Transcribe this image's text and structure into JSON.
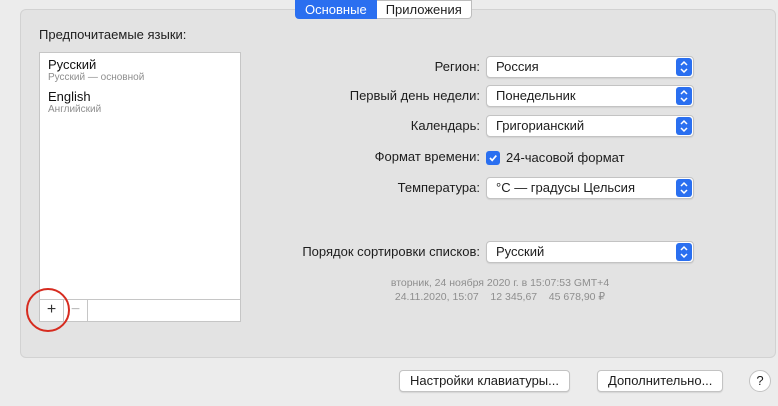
{
  "tabs": {
    "active": "Основные",
    "inactive": "Приложения"
  },
  "languages": {
    "title": "Предпочитаемые языки:",
    "items": [
      {
        "name": "Русский",
        "sub": "Русский — основной"
      },
      {
        "name": "English",
        "sub": "Английский"
      }
    ],
    "add": "+",
    "remove": "−"
  },
  "settings": {
    "region_label": "Регион:",
    "region_value": "Россия",
    "week_label": "Первый день недели:",
    "week_value": "Понедельник",
    "calendar_label": "Календарь:",
    "calendar_value": "Григорианский",
    "time_label": "Формат времени:",
    "time_value": "24-часовой формат",
    "temp_label": "Температура:",
    "temp_value": "°C — градусы Цельсия",
    "sort_label": "Порядок сортировки списков:",
    "sort_value": "Русский"
  },
  "sample": {
    "line1": "вторник, 24 ноября 2020 г. в 15:07:53 GMT+4",
    "line2": "24.11.2020, 15:07    12 345,67    45 678,90 ₽"
  },
  "buttons": {
    "keyboard": "Настройки клавиатуры...",
    "advanced": "Дополнительно...",
    "help": "?"
  },
  "colors": {
    "accent": "#2a6ff0",
    "highlight_circle": "#d62b1f"
  }
}
